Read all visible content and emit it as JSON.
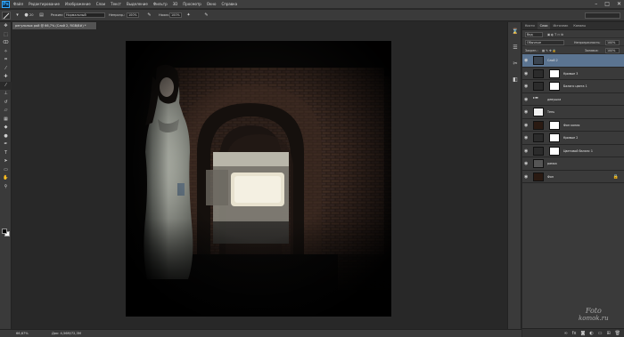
{
  "menu": {
    "logo": "Ps",
    "items": [
      "Файл",
      "Редактирование",
      "Изображение",
      "Слои",
      "Текст",
      "Выделение",
      "Фильтр",
      "3D",
      "Просмотр",
      "Окно",
      "Справка"
    ],
    "window_controls": [
      "–",
      "□",
      "✕"
    ]
  },
  "options": {
    "mode_label": "Режим:",
    "mode_value": "Нормальный",
    "opacity_label": "Непрозр.:",
    "opacity_value": "100%",
    "flow_label": "Нажм.:",
    "flow_value": "100%",
    "brush_size": "20"
  },
  "document": {
    "tab_title": "регульных рой @ 66,7% (Слой 2, RGB/8#) *",
    "zoom": "66,67%",
    "doc_size": "Док: 4,56M/72,3M"
  },
  "panel": {
    "tabs": [
      "Кисти",
      "Слои",
      "Источник",
      "Каналы"
    ],
    "active_tab": "Слои",
    "kind_label": "Вид",
    "blend_mode": "Обычные",
    "opacity_label": "Непрозрачность:",
    "opacity_value": "100%",
    "lock_label": "Закреп.:",
    "fill_label": "Заливка:",
    "fill_value": "100%",
    "layers": [
      {
        "name": "Слой 2",
        "selected": true,
        "thumb": "girl",
        "mask": false
      },
      {
        "name": "Кривые 3",
        "selected": false,
        "thumb": "adj",
        "mask": true
      },
      {
        "name": "Баланс цвета 1",
        "selected": false,
        "thumb": "adj",
        "mask": true
      },
      {
        "name": "девушка",
        "selected": false,
        "thumb": "folder",
        "mask": false
      },
      {
        "name": "Тень",
        "selected": false,
        "thumb": "white",
        "mask": false
      },
      {
        "name": "Фон копия",
        "selected": false,
        "thumb": "dark",
        "mask": true
      },
      {
        "name": "Кривые 2",
        "selected": false,
        "thumb": "adj",
        "mask": true
      },
      {
        "name": "Цветовой баланс 1",
        "selected": false,
        "thumb": "adj",
        "mask": true
      },
      {
        "name": "рамка",
        "selected": false,
        "thumb": "frame",
        "mask": false
      },
      {
        "name": "Фон",
        "selected": false,
        "thumb": "dark",
        "mask": false
      }
    ]
  },
  "watermark": {
    "line1": "Foto",
    "line2": "komok.ru"
  },
  "colors": {
    "menu_bg": "#3e3e3e",
    "panel_bg": "#3a3a3a",
    "workspace": "#282828",
    "selection": "#5b7491",
    "ps_blue": "#31a8ff"
  }
}
